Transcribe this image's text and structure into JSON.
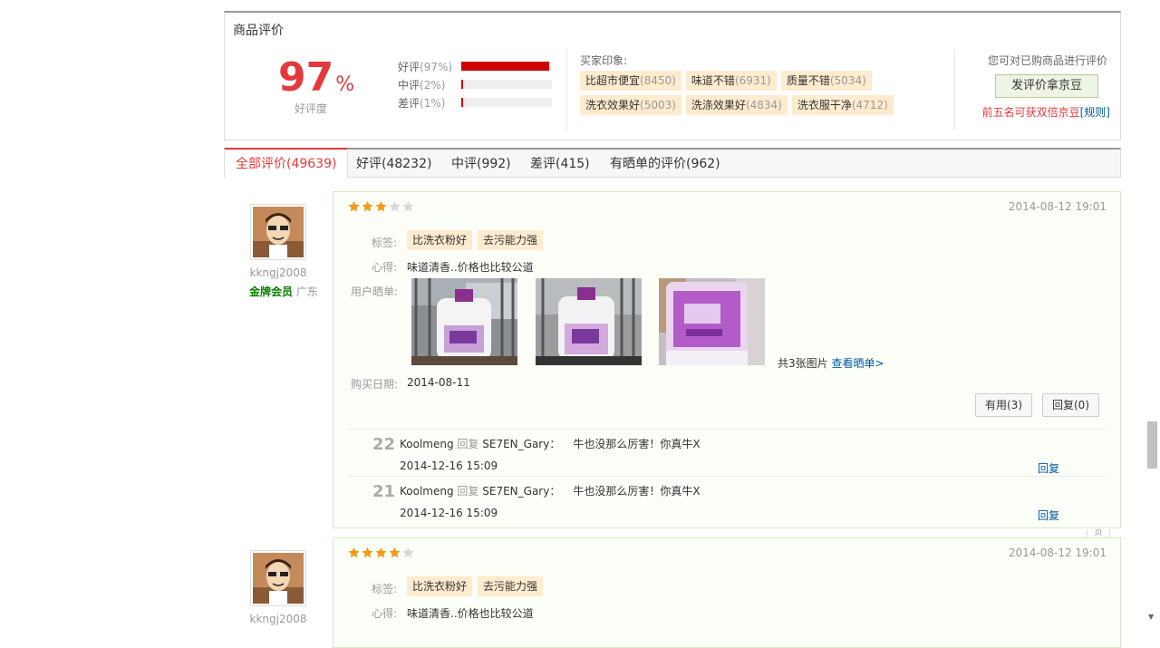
{
  "summary": {
    "title": "商品评价",
    "rate": "97",
    "rate_unit": "%",
    "rate_label": "好评度",
    "bars": [
      {
        "label": "好评",
        "pct_text": "(97%)",
        "value": 0.97
      },
      {
        "label": "中评",
        "pct_text": "(2%)",
        "value": 0.02
      },
      {
        "label": "差评",
        "pct_text": "(1%)",
        "value": 0.01
      }
    ],
    "impression_title": "买家印象:",
    "impressions": [
      {
        "name": "比超市便宜",
        "count": "(8450)"
      },
      {
        "name": "味道不错",
        "count": "(6931)"
      },
      {
        "name": "质量不错",
        "count": "(5034)"
      },
      {
        "name": "洗衣效果好",
        "count": "(5003)"
      },
      {
        "name": "洗涤效果好",
        "count": "(4834)"
      },
      {
        "name": "洗衣服干净",
        "count": "(4712)"
      }
    ],
    "side_text": "您可对已购商品进行评价",
    "side_button": "发评价拿京豆",
    "side_note": "前五名可获双倍京豆",
    "side_rule": "[规则]"
  },
  "tabs": [
    {
      "label": "全部评价(49639)",
      "active": true
    },
    {
      "label": "好评(48232)",
      "active": false
    },
    {
      "label": "中评(992)",
      "active": false
    },
    {
      "label": "差评(415)",
      "active": false
    },
    {
      "label": "有晒单的评价(962)",
      "active": false
    }
  ],
  "reviews": [
    {
      "username": "kkngj2008",
      "level": "金牌会员",
      "region": "广东",
      "stars": 3,
      "date": "2014-08-12 19:01",
      "tags_label": "标签:",
      "tags": [
        "比洗衣粉好",
        "去污能力强"
      ],
      "comment_label": "心得:",
      "comment": "味道清香..价格也比较公道",
      "photos_label": "用户晒单:",
      "photo_count_text": "共3张图片",
      "photo_link": "查看晒单>",
      "buy_date_label": "购买日期:",
      "buy_date": "2014-08-11",
      "useful_btn": "有用(3)",
      "reply_btn": "回复(0)",
      "replies": [
        {
          "floor": "22",
          "user": "Koolmeng",
          "reply_word": "回复",
          "to": "SE7EN_Gary：",
          "content": "牛也没那么厉害！你真牛X",
          "date": "2014-12-16 15:09",
          "action": "回复"
        },
        {
          "floor": "21",
          "user": "Koolmeng",
          "reply_word": "回复",
          "to": "SE7EN_Gary：",
          "content": "牛也没那么厉害！你真牛X",
          "date": "2014-12-16 15:09",
          "action": "回复"
        }
      ]
    },
    {
      "username": "kkngj2008",
      "stars": 4,
      "date": "2014-08-12 19:01",
      "tags_label": "标签:",
      "tags": [
        "比洗衣粉好",
        "去污能力强"
      ],
      "comment_label": "心得:",
      "comment": "味道清香..价格也比较公道"
    }
  ],
  "ghost_tab_text": "页",
  "colors": {
    "accent": "#e4393c",
    "link": "#005aa0",
    "tag_bg": "#ffebce",
    "card_border": "#d7e9c3"
  }
}
